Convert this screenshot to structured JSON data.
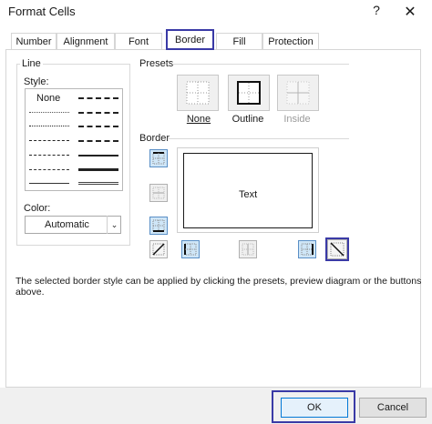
{
  "window": {
    "title": "Format Cells",
    "help_glyph": "?",
    "close_glyph": "✕"
  },
  "tabs": [
    {
      "label": "Number"
    },
    {
      "label": "Alignment"
    },
    {
      "label": "Font"
    },
    {
      "label": "Border",
      "selected": true
    },
    {
      "label": "Fill"
    },
    {
      "label": "Protection"
    }
  ],
  "line": {
    "group_label": "Line",
    "style_label": "Style:",
    "style_none": "None",
    "color_label": "Color:",
    "color_value": "Automatic",
    "color_arrow": "⌄"
  },
  "presets": {
    "group_label": "Presets",
    "none_label": "None",
    "outline_label": "Outline",
    "inside_label": "Inside"
  },
  "border": {
    "group_label": "Border",
    "preview_text": "Text"
  },
  "info": "The selected border style can be applied by clicking the presets, preview diagram or the buttons above.",
  "footer": {
    "ok_label": "OK",
    "cancel_label": "Cancel"
  },
  "colors": {
    "highlight": "#3a3aa6",
    "active_button": "#cfe6f7",
    "ok_border": "#0078d7"
  }
}
